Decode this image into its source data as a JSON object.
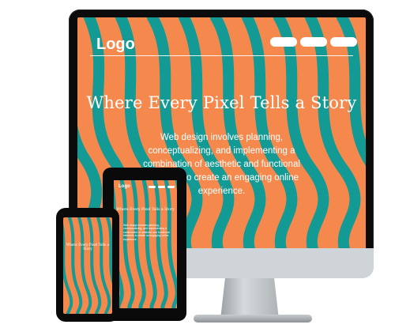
{
  "colors": {
    "orange": "#F5894D",
    "teal": "#149A94",
    "frame": "#0B0B0B",
    "stand": "#C9CED1",
    "text": "#FFFFFF"
  },
  "desktop": {
    "logo": "Logo",
    "nav_pills": 3,
    "title": "Where Every Pixel Tells a Story",
    "description": "Web design involves planning, conceptualizing, and implementing a combination of aesthetic and functional elements to create an engaging online experience."
  },
  "tablet": {
    "logo": "Logo",
    "title": "Where Every Pixel Tells a Story",
    "description": "Web design involves planning, conceptualizing, and implementing a combination of aesthetic and functional elements to create an engaging online experience."
  },
  "phone": {
    "title": "Where Every Pixel Tells a Story"
  }
}
